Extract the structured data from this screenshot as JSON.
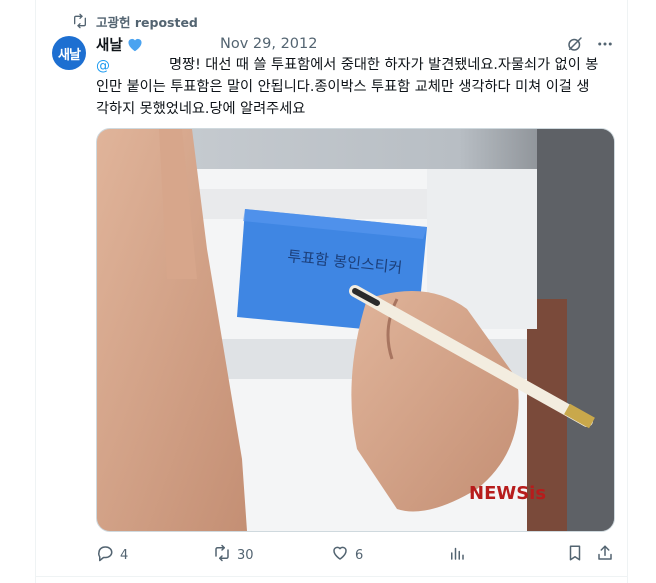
{
  "repost": {
    "label": "고광헌 reposted"
  },
  "author": {
    "name": "새날",
    "avatar_text": "새날",
    "badge": "blue-heart"
  },
  "post": {
    "date": "Nov 29, 2012",
    "mention": "@",
    "text_line1": "명짱! 대선 때 쓸 투표함에서 중대한 하자가 발견됐네요.자물쇠가 없이 봉",
    "text_line2": "인만 붙이는 투표함은 말이 안됩니다.종이박스 투표함 교체만 생각하다 미쳐 이걸 생",
    "text_line3": "각하지 못했었네요.당에 알려주세요"
  },
  "media": {
    "seal_text": "투표함 봉인스티커",
    "watermark": "NEWSis"
  },
  "actions": {
    "replies": "4",
    "reposts": "30",
    "likes": "6"
  },
  "colors": {
    "accent": "#1d9bf0",
    "muted": "#536471",
    "avatar": "#1d6fd1",
    "seal": "#3b82e0"
  }
}
